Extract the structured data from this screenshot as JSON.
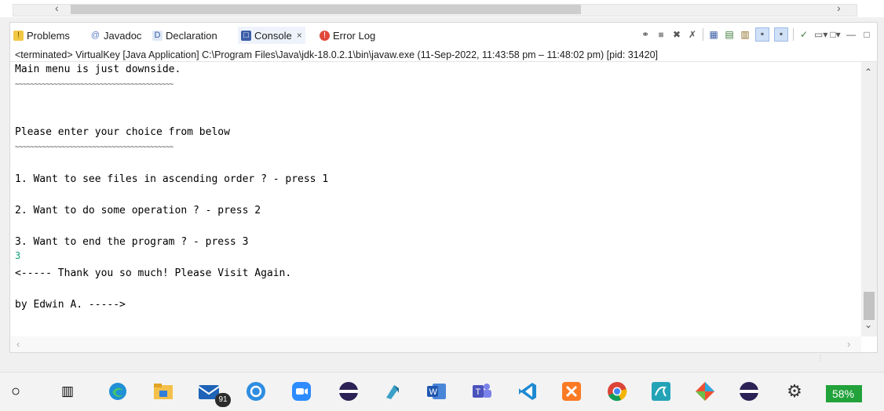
{
  "tabs": [
    {
      "label": "Problems",
      "icon": "problems-icon"
    },
    {
      "label": "Javadoc",
      "icon": "javadoc-icon"
    },
    {
      "label": "Declaration",
      "icon": "declaration-icon"
    },
    {
      "label": "Console",
      "icon": "console-icon",
      "active": true
    },
    {
      "label": "Error Log",
      "icon": "error-log-icon"
    }
  ],
  "status_line": "<terminated> VirtualKey [Java Application] C:\\Program Files\\Java\\jdk-18.0.2.1\\bin\\javaw.exe  (11-Sep-2022, 11:43:58 pm – 11:48:02 pm) [pid: 31420]",
  "console": {
    "lines": [
      "Main menu is just downside.",
      "~~~~~~~~~~~~~~~~~~~~~~~~~~~~~~~~~~~~~~~~~",
      "Please enter your choice from below",
      "~~~~~~~~~~~~~~~~~~~~~~~~~~~~~~~~~~~~~~~~~",
      "1. Want to see files in ascending order ? - press 1",
      "2. Want to do some operation ? - press 2",
      "3. Want to end the program ? - press 3",
      "3",
      "<----- Thank you so much! Please Visit Again.",
      "by Edwin A. ----->"
    ]
  },
  "taskbar": {
    "mail_badge": "91",
    "battery": "58%",
    "apps": [
      "start-icon",
      "task-view-icon",
      "edge-icon",
      "file-explorer-icon",
      "mail-icon",
      "app-icon",
      "zoom-icon",
      "eclipse-icon",
      "notes-icon",
      "word-icon",
      "teams-icon",
      "vscode-icon",
      "xampp-icon",
      "chrome-icon",
      "mysql-icon",
      "git-icon",
      "eclipse-icon-2",
      "settings-icon"
    ]
  },
  "colors": {
    "console_input": "#10a07a",
    "battery": "#22a23a",
    "active_tab": "#eef3fb"
  }
}
